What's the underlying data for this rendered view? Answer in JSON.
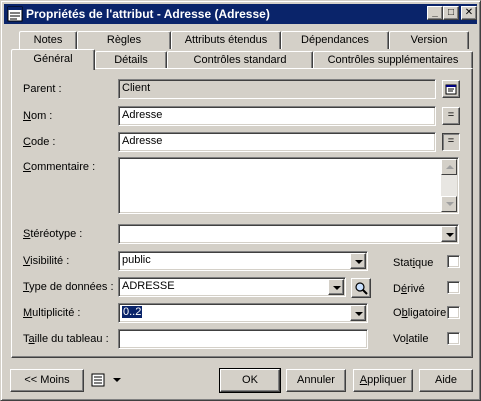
{
  "window": {
    "title": "Propriétés de l'attribut - Adresse (Adresse)",
    "minimize_glyph": "_",
    "maximize_glyph": "□",
    "close_glyph": "✕"
  },
  "tabs_back": [
    "Notes",
    "Règles",
    "Attributs étendus",
    "Dépendances",
    "Version"
  ],
  "tabs_front": [
    "Général",
    "Détails",
    "Contrôles standard",
    "Contrôles supplémentaires"
  ],
  "active_tab": "Général",
  "form": {
    "parent_label": "Parent :",
    "parent_value": "Client",
    "nom_label_u": "N",
    "nom_label_rest": "om :",
    "nom_value": "Adresse",
    "code_label_u": "C",
    "code_label_rest": "ode :",
    "code_value": "Adresse",
    "equals_glyph": "=",
    "commentaire_label_u": "C",
    "commentaire_label_rest": "ommentaire :",
    "commentaire_value": "",
    "stereotype_label_u": "S",
    "stereotype_label_rest": "téréotype :",
    "stereotype_value": "",
    "visibilite_label_u": "V",
    "visibilite_label_rest": "isibilité :",
    "visibilite_value": "public",
    "type_label_u": "T",
    "type_label_rest": "ype de données :",
    "type_value": "ADRESSE",
    "multiplicite_label_u": "M",
    "multiplicite_label_rest": "ultiplicité :",
    "multiplicite_value": "0..2",
    "taille_label_pre": "T",
    "taille_label_u": "a",
    "taille_label_rest": "ille du tableau :",
    "taille_value": ""
  },
  "checkboxes": {
    "statique_pre": "Stat",
    "statique_u": "i",
    "statique_rest": "que",
    "statique_checked": false,
    "derive_pre": "D",
    "derive_u": "é",
    "derive_rest": "rivé",
    "derive_checked": false,
    "obligatoire_pre": "O",
    "obligatoire_u": "b",
    "obligatoire_rest": "ligatoire",
    "obligatoire_checked": false,
    "volatile_pre": "Vo",
    "volatile_u": "l",
    "volatile_rest": "atile",
    "volatile_checked": false
  },
  "buttons": {
    "moins": "<< Moins",
    "ok": "OK",
    "annuler": "Annuler",
    "appliquer_u": "A",
    "appliquer_rest": "ppliquer",
    "aide": "Aide"
  },
  "colors": {
    "face": "#d4d0c8",
    "titlebar": "#0a246a",
    "selection": "#0a246a"
  }
}
